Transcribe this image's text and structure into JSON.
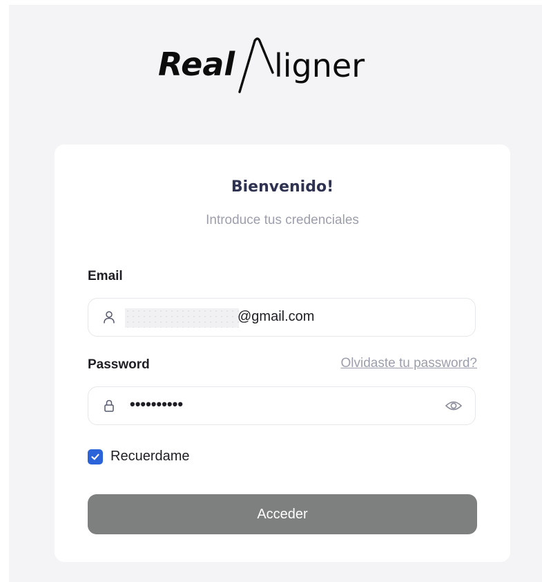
{
  "brand": {
    "logo_word_1": "Real",
    "logo_word_2": "ligner"
  },
  "card": {
    "title": "Bienvenido!",
    "subtitle": "Introduce tus credenciales"
  },
  "form": {
    "email_label": "Email",
    "email_value_visible": "@gmail.com",
    "password_label": "Password",
    "forgot_link": "Olvidaste tu password?",
    "password_mask": "••••••••••",
    "remember_label": "Recuerdame",
    "remember_checked": true,
    "submit_label": "Acceder"
  },
  "icons": {
    "email": "user-icon",
    "password": "lock-icon",
    "show_password": "eye-icon",
    "checkbox": "check-icon"
  },
  "colors": {
    "page_background": "#f4f4f6",
    "card_background": "#ffffff",
    "title": "#2f3250",
    "muted_text": "#9c9fab",
    "checkbox": "#2b64d9",
    "submit_button": "#7e7f7f"
  }
}
